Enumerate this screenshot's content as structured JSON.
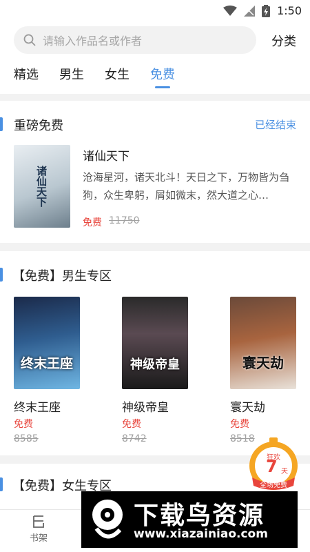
{
  "status": {
    "time": "1:50"
  },
  "search": {
    "placeholder": "请输入作品名或作者",
    "category_label": "分类"
  },
  "tabs": [
    {
      "label": "精选",
      "active": false
    },
    {
      "label": "男生",
      "active": false
    },
    {
      "label": "女生",
      "active": false
    },
    {
      "label": "免费",
      "active": true
    }
  ],
  "featured": {
    "title": "重磅免费",
    "status_link": "已经结束",
    "book": {
      "title": "诸仙天下",
      "description": "沧海星河，诸天北斗！天日之下，万物皆为刍狗，众生卑躬，屑如微末，然大道之心…",
      "free_label": "免费",
      "original_price": "11750",
      "cover_text": "诸仙天下"
    }
  },
  "male_zone": {
    "title": "【免费】男生专区",
    "books": [
      {
        "title": "终末王座",
        "free_label": "免费",
        "original_price": "8585",
        "cover_text": "终末王座"
      },
      {
        "title": "神级帝皇",
        "free_label": "免费",
        "original_price": "8742",
        "cover_text": "神级帝皇"
      },
      {
        "title": "寰天劫",
        "free_label": "免费",
        "original_price": "8518",
        "cover_text": "寰天劫"
      }
    ]
  },
  "female_zone": {
    "title": "【免费】女生专区"
  },
  "bottom_nav": {
    "items": [
      {
        "label": "书架",
        "icon": "bookshelf-icon"
      }
    ]
  },
  "badge": {
    "top": "狂欢",
    "number": "7",
    "unit": "天",
    "bottom": "全场免费"
  },
  "watermark": {
    "title": "下载鸟资源",
    "url": "www.xiazainiao.com"
  },
  "colors": {
    "accent": "#4a90e2",
    "free": "#e8453c",
    "badge": "#f5a623"
  }
}
